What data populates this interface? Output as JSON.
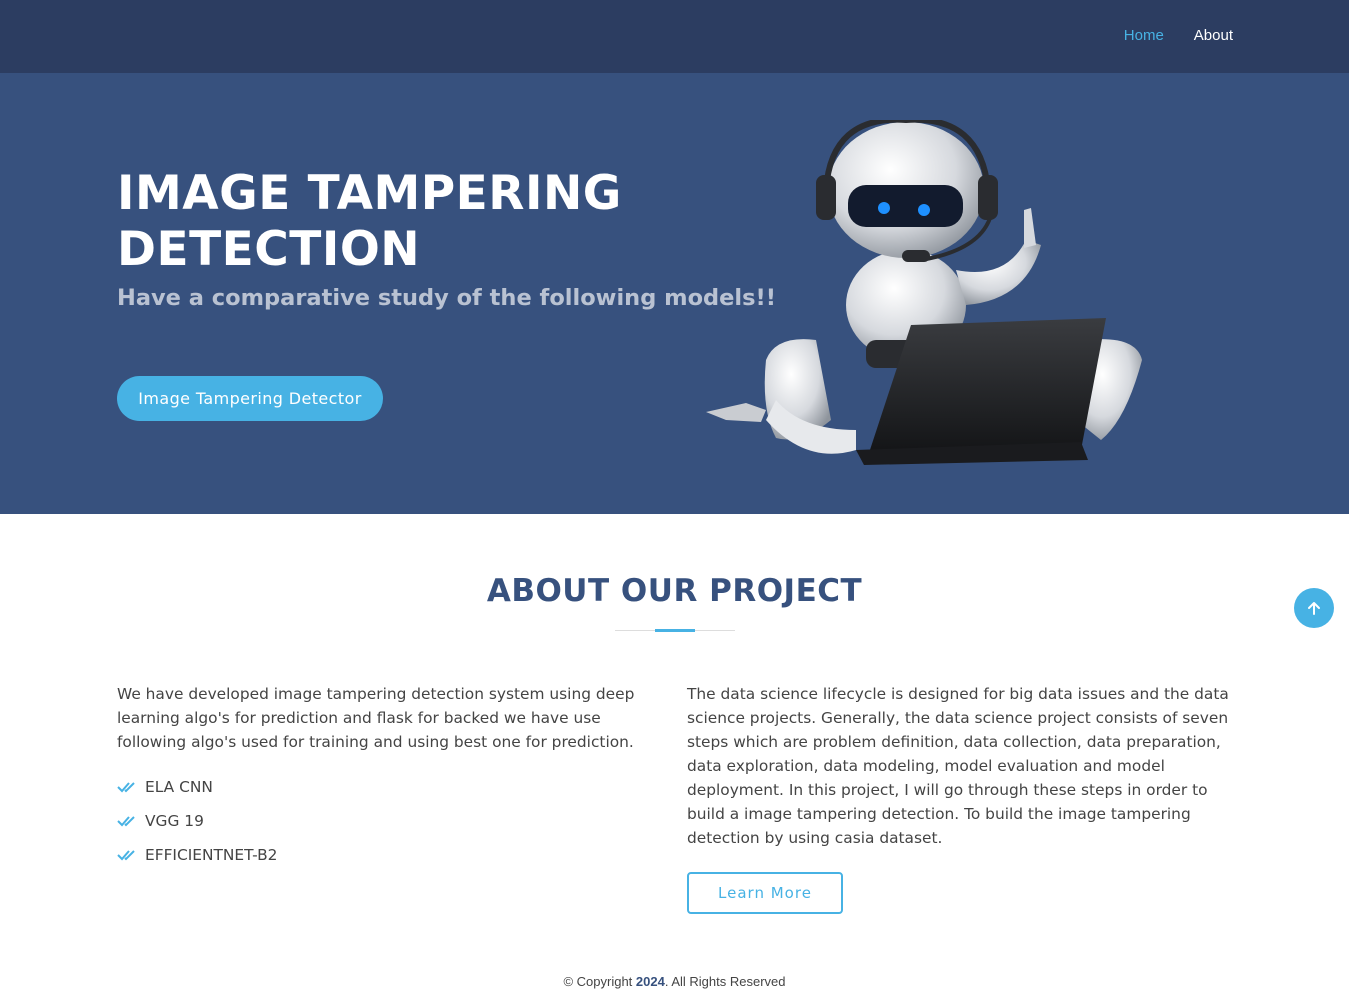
{
  "nav": {
    "items": [
      {
        "label": "Home",
        "active": true
      },
      {
        "label": "About",
        "active": false
      }
    ]
  },
  "hero": {
    "title": "IMAGE TAMPERING DETECTION",
    "subtitle": "Have a comparative study of the following models!!",
    "button_label": "Image Tampering Detector",
    "image_icon": "robot-with-laptop"
  },
  "about": {
    "title": "ABOUT OUR PROJECT",
    "left_paragraph": "We have developed image tampering detection system using deep learning algo's for prediction and flask for backed we have use following algo's used for training and using best one for prediction.",
    "models": [
      "ELA CNN",
      "VGG 19",
      "EFFICIENTNET-B2"
    ],
    "right_paragraph": "The data science lifecycle is designed for big data issues and the data science projects. Generally, the data science project consists of seven steps which are problem definition, data collection, data preparation, data exploration, data modeling, model evaluation and model deployment. In this project, I will go through these steps in order to build a image tampering detection. To build the image tampering detection by using casia dataset.",
    "learn_more_label": "Learn More"
  },
  "footer": {
    "prefix": "© Copyright ",
    "year": "2024",
    "suffix": ". All Rights Reserved"
  },
  "colors": {
    "header_bg": "#2c3d61",
    "hero_bg": "#37517e",
    "accent": "#47b2e4",
    "title_text": "#37517e"
  }
}
